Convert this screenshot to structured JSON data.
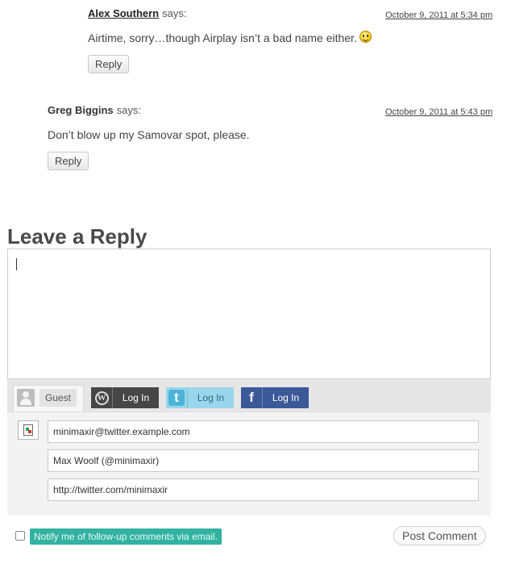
{
  "comments": [
    {
      "author": "Alex Southern",
      "says": "says:",
      "date": "October 9, 2011 at 5:34 pm",
      "body": "Airtime, sorry…though Airplay isn’t a bad name either.",
      "emoticon": "smiley-icon",
      "reply_label": "Reply"
    },
    {
      "author": "Greg Biggins",
      "says": "says:",
      "date": "October 9, 2011 at 5:43 pm",
      "body": "Don’t blow up my Samovar spot, please.",
      "reply_label": "Reply"
    }
  ],
  "reply_form": {
    "title": "Leave a Reply",
    "textarea_value": "",
    "tabs": [
      {
        "label": "Guest",
        "icon": "guest-user-icon"
      },
      {
        "label": "Log In",
        "icon": "wordpress-icon"
      },
      {
        "label": "Log In",
        "icon": "twitter-icon"
      },
      {
        "label": "Log In",
        "icon": "facebook-icon"
      }
    ],
    "email_value": "minimaxir@twitter.example.com",
    "name_value": "Max Woolf (@minimaxir)",
    "website_value": "http://twitter.com/minimaxir",
    "notify_label": "Notify me of follow-up comments via email.",
    "notify_checked": false,
    "submit_label": "Post Comment"
  },
  "colors": {
    "wordpress_tab": "#464646",
    "twitter_tab": "#9ad6eb",
    "facebook_tab": "#3b5998",
    "notify_highlight": "#32b2a0"
  }
}
